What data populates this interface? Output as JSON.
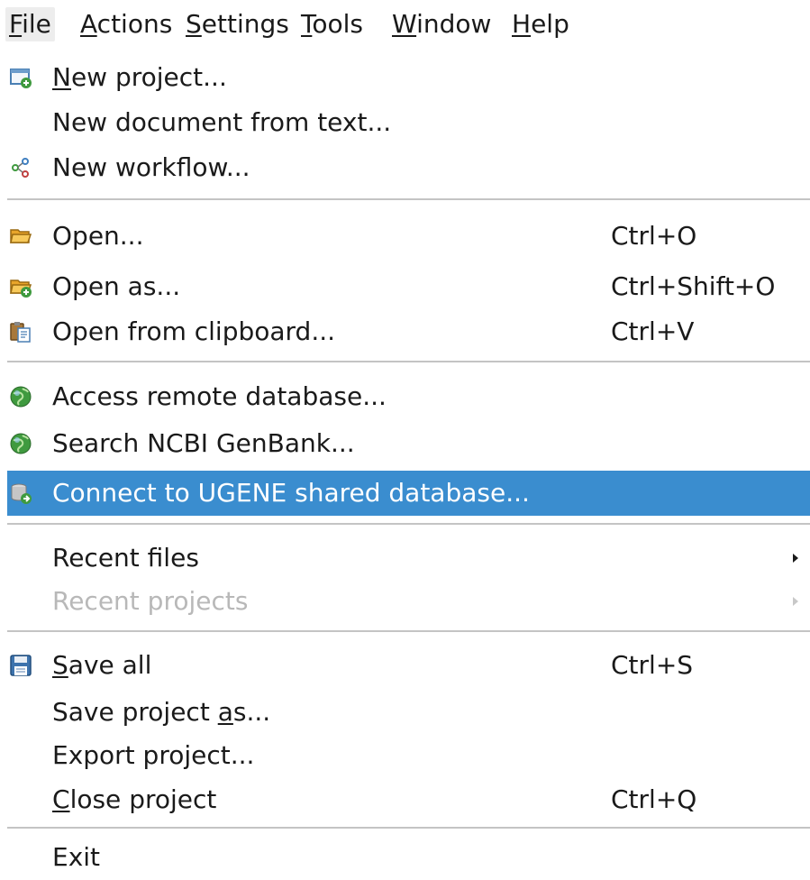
{
  "menubar": {
    "items": [
      {
        "label": "File",
        "mnemonic_index": 0
      },
      {
        "label": "Actions",
        "mnemonic_index": 0
      },
      {
        "label": "Settings",
        "mnemonic_index": 0
      },
      {
        "label": "Tools",
        "mnemonic_index": 0
      },
      {
        "label": "Window",
        "mnemonic_index": 0
      },
      {
        "label": "Help",
        "mnemonic_index": 0
      }
    ],
    "active": "File"
  },
  "file_menu": {
    "items": [
      {
        "label": "New project...",
        "shortcut": "",
        "icon": "new-project-icon"
      },
      {
        "label": "New document from text...",
        "shortcut": "",
        "icon": ""
      },
      {
        "label": "New workflow...",
        "shortcut": "",
        "icon": "workflow-icon"
      },
      {
        "label": "Open...",
        "shortcut": "Ctrl+O",
        "icon": "folder-open-icon"
      },
      {
        "label": "Open as...",
        "shortcut": "Ctrl+Shift+O",
        "icon": "folder-open-as-icon"
      },
      {
        "label": "Open from clipboard...",
        "shortcut": "Ctrl+V",
        "icon": "clipboard-icon"
      },
      {
        "label": "Access remote database...",
        "shortcut": "",
        "icon": "globe-icon"
      },
      {
        "label": "Search NCBI GenBank...",
        "shortcut": "",
        "icon": "globe-icon"
      },
      {
        "label": "Connect to UGENE shared database...",
        "shortcut": "",
        "icon": "database-connect-icon",
        "highlighted": true
      },
      {
        "label": "Recent files",
        "shortcut": "",
        "icon": "",
        "submenu": true
      },
      {
        "label": "Recent projects",
        "shortcut": "",
        "icon": "",
        "submenu": true,
        "disabled": true
      },
      {
        "label": "Save all",
        "shortcut": "Ctrl+S",
        "icon": "floppy-disk-icon"
      },
      {
        "label": "Save project as...",
        "shortcut": "",
        "icon": ""
      },
      {
        "label": "Export project...",
        "shortcut": "",
        "icon": ""
      },
      {
        "label": "Close project",
        "shortcut": "Ctrl+Q",
        "icon": ""
      },
      {
        "label": "Exit",
        "shortcut": "",
        "icon": ""
      }
    ]
  },
  "colors": {
    "highlight": "#3a8dcf",
    "disabled_text": "#b8b8b8",
    "separator": "#c4c4c4"
  }
}
